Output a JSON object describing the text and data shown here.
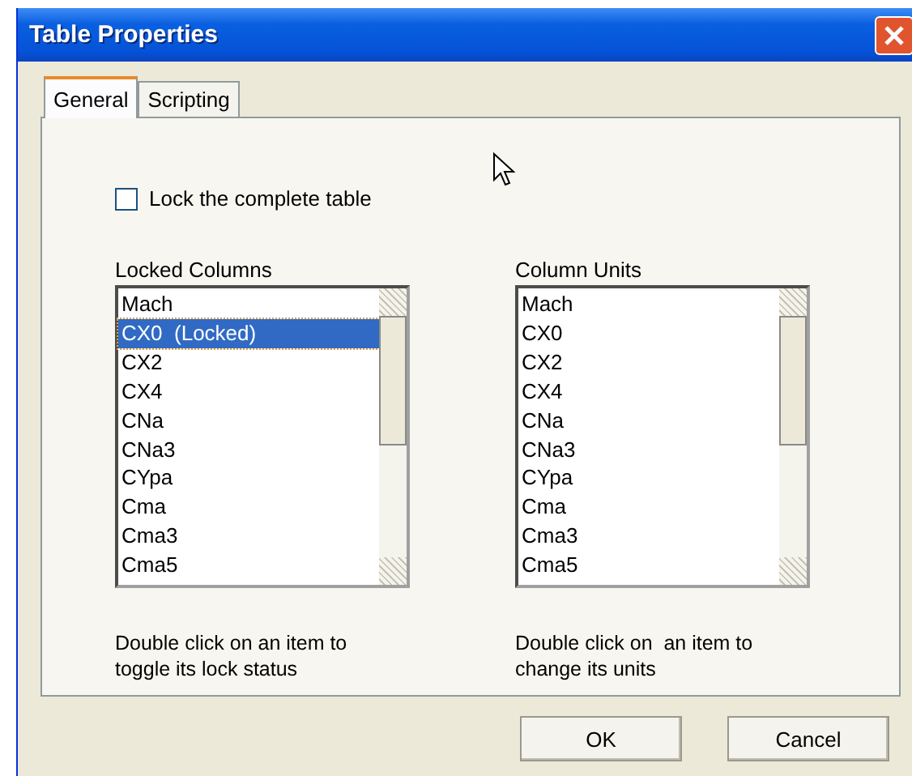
{
  "window": {
    "title": "Table Properties"
  },
  "tabs": [
    {
      "label": "General",
      "selected": true
    },
    {
      "label": "Scripting",
      "selected": false
    }
  ],
  "lock_table": {
    "label": "Lock the complete table",
    "checked": false
  },
  "lists": [
    {
      "label": "Locked Columns",
      "items": [
        {
          "text": "Mach",
          "selected": false
        },
        {
          "text": "CX0  (Locked)",
          "selected": true
        },
        {
          "text": "CX2",
          "selected": false
        },
        {
          "text": "CX4",
          "selected": false
        },
        {
          "text": "CNa",
          "selected": false
        },
        {
          "text": "CNa3",
          "selected": false
        },
        {
          "text": "CYpa",
          "selected": false
        },
        {
          "text": "Cma",
          "selected": false
        },
        {
          "text": "Cma3",
          "selected": false
        },
        {
          "text": "Cma5",
          "selected": false
        }
      ],
      "hint_lines": [
        "Double click on an item to",
        "toggle its lock status"
      ]
    },
    {
      "label": "Column Units",
      "items": [
        {
          "text": "Mach",
          "selected": false
        },
        {
          "text": "CX0",
          "selected": false
        },
        {
          "text": "CX2",
          "selected": false
        },
        {
          "text": "CX4",
          "selected": false
        },
        {
          "text": "CNa",
          "selected": false
        },
        {
          "text": "CNa3",
          "selected": false
        },
        {
          "text": "CYpa",
          "selected": false
        },
        {
          "text": "Cma",
          "selected": false
        },
        {
          "text": "Cma3",
          "selected": false
        },
        {
          "text": "Cma5",
          "selected": false
        }
      ],
      "hint_lines": [
        "Double click on  an item to",
        "change its units"
      ]
    }
  ],
  "buttons": [
    "OK",
    "Cancel"
  ]
}
